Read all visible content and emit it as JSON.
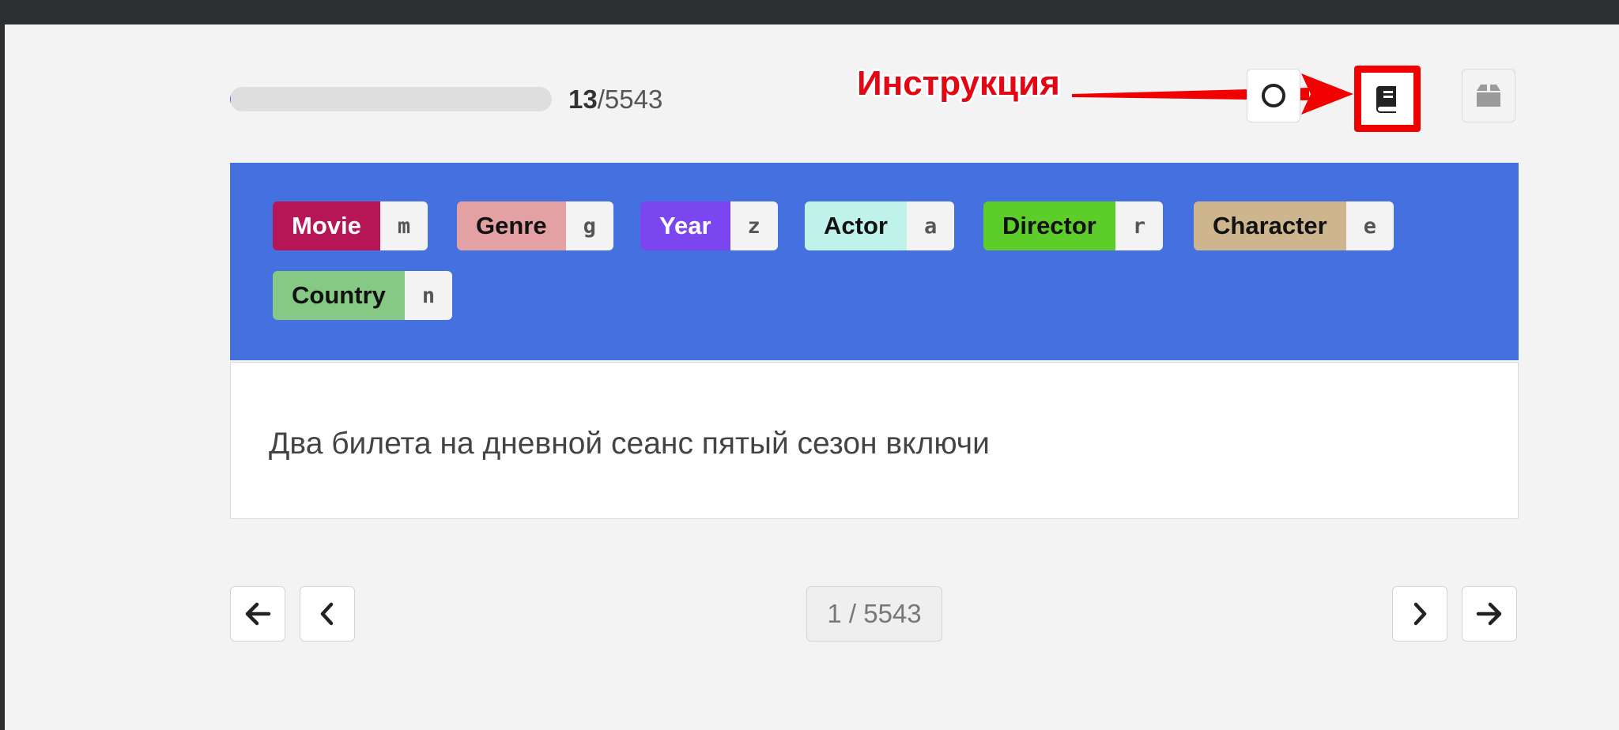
{
  "progress": {
    "done": "13",
    "total": "/5543",
    "fraction": 0.0023
  },
  "toolbar": {
    "annotation_text": "Инструкция",
    "circle_icon": "circle-icon",
    "book_icon": "book-icon",
    "box_icon": "box-icon",
    "highlight_color": "#f00100"
  },
  "labels": [
    {
      "name": "Movie",
      "key": "m",
      "color": "#b71656",
      "text_color": "#ffffff"
    },
    {
      "name": "Genre",
      "key": "g",
      "color": "#e4a1a3",
      "text_color": "#111111"
    },
    {
      "name": "Year",
      "key": "z",
      "color": "#7b45ef",
      "text_color": "#ffffff"
    },
    {
      "name": "Actor",
      "key": "a",
      "color": "#bff3ea",
      "text_color": "#111111"
    },
    {
      "name": "Director",
      "key": "r",
      "color": "#5dce29",
      "text_color": "#111111"
    },
    {
      "name": "Character",
      "key": "e",
      "color": "#cdb68e",
      "text_color": "#111111"
    },
    {
      "name": "Country",
      "key": "n",
      "color": "#86c985",
      "text_color": "#111111"
    }
  ],
  "panel_color": "#4570e0",
  "sentence": "Два билета на дневной сеанс пятый сезон включи",
  "pagination": {
    "indicator": "1 / 5543",
    "first_icon": "arrow-left-icon",
    "prev_icon": "chevron-left-icon",
    "next_icon": "chevron-right-icon",
    "last_icon": "arrow-right-icon"
  }
}
